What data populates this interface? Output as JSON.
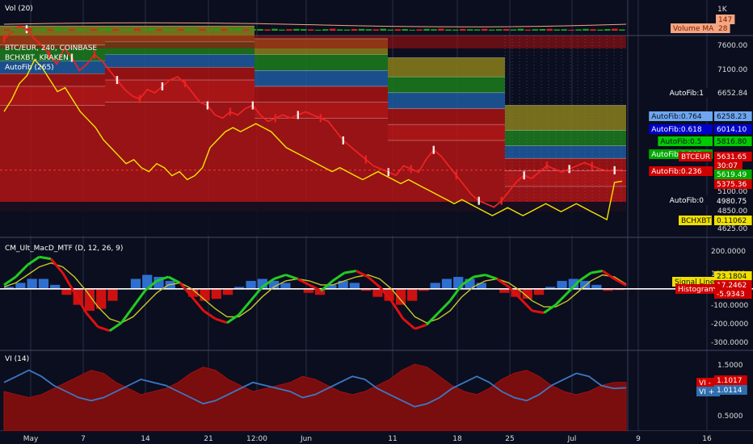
{
  "panes": {
    "volume": {
      "label": "Vol (20)",
      "axis_ticks": [
        "1K"
      ],
      "badges": [
        {
          "text": "147",
          "bg": "#f4a582",
          "fg": "#7a1e00"
        },
        {
          "text": "Volume MA",
          "bg": "#f4a582",
          "fg": "#7a1e00"
        },
        {
          "text": "28",
          "bg": "#f4a582",
          "fg": "#7a1e00"
        }
      ]
    },
    "price": {
      "labels": [
        "BTC/EUR, 240, COINBASE",
        "BCHXBT, KRAKEN",
        "AutoFib (265)"
      ],
      "axis_ticks": [
        "7600.00",
        "7100.00",
        "6652.84",
        "5100.00",
        "4850.00",
        "4625.00"
      ],
      "fib_labels": [
        "AutoFib:1",
        "AutoFib:0.764",
        "AutoFib:0.618",
        "AutoFib:0.5",
        "AutoFib:0.382",
        "AutoFib:0.236",
        "AutoFib:0"
      ],
      "badges": [
        {
          "text": "6258.23",
          "bg": "#6ea6f0",
          "fg": "#0b0e1e"
        },
        {
          "text": "6014.10",
          "bg": "#0000cc",
          "fg": "#ffffff"
        },
        {
          "text": "5816.80",
          "bg": "#00cc00",
          "fg": "#0b0e1e"
        },
        {
          "text": "BTCEUR",
          "bg": "#d00000",
          "fg": "#ffffff"
        },
        {
          "text": "5631.65",
          "bg": "#d00000",
          "fg": "#ffffff"
        },
        {
          "text": "30:07",
          "bg": "#d00000",
          "fg": "#ffffff"
        },
        {
          "text": "5619.49",
          "bg": "#00aa00",
          "fg": "#ffffff"
        },
        {
          "text": "5375.36",
          "bg": "#d00000",
          "fg": "#ffffff"
        },
        {
          "text": "4980.75",
          "bg": "#0b0e1e",
          "fg": "#ffffff"
        },
        {
          "text": "BCHXBT",
          "bg": "#f0e000",
          "fg": "#0b0e1e"
        },
        {
          "text": "0.11062",
          "bg": "#f0e000",
          "fg": "#0b0e1e"
        }
      ]
    },
    "macd": {
      "label": "CM_Ult_MacD_MTF (D, 12, 26, 9)",
      "axis_ticks": [
        "200.0000",
        "100.0000",
        "-100.0000",
        "-200.0000",
        "-300.0000"
      ],
      "badges": [
        {
          "text": "Signal Line",
          "bg": "#f0e000",
          "fg": "#0b0e1e"
        },
        {
          "text": "23.1804",
          "bg": "#f0e000",
          "fg": "#0b0e1e"
        },
        {
          "text": "17.2462",
          "bg": "#d00000",
          "fg": "#ffffff"
        },
        {
          "text": "Histogram",
          "bg": "#d00000",
          "fg": "#ffffff"
        },
        {
          "text": "-5.9343",
          "bg": "#d00000",
          "fg": "#ffffff"
        }
      ]
    },
    "vi": {
      "label": "VI (14)",
      "axis_ticks": [
        "1.5000",
        "0.5000"
      ],
      "badges": [
        {
          "text": "VI -",
          "bg": "#d00000",
          "fg": "#ffffff"
        },
        {
          "text": "1.1017",
          "bg": "#d00000",
          "fg": "#ffffff"
        },
        {
          "text": "VI +",
          "bg": "#2f6fb0",
          "fg": "#ffffff"
        },
        {
          "text": "1.0114",
          "bg": "#2f6fb0",
          "fg": "#ffffff"
        }
      ]
    }
  },
  "x_axis": [
    "May",
    "7",
    "14",
    "21",
    "12:00",
    "Jun",
    "11",
    "18",
    "25",
    "Jul",
    "9",
    "16"
  ],
  "colors": {
    "background": "#0b0e1e",
    "grid": "#2a2f48",
    "red": "#cc1111",
    "orange": "#d2691e",
    "yellow": "#f2e600",
    "green": "#1e9e1e",
    "blue": "#2b6cc4",
    "price_up": "#ffffff",
    "price_down": "#ee2222",
    "vi_plus": "#3b79c4",
    "vi_minus": "#8b1010"
  },
  "chart_data": [
    {
      "type": "bar",
      "title": "Vol (20)",
      "note_series": "volume bars (approx.)",
      "values": [
        40,
        55,
        30,
        70,
        45,
        60,
        35,
        90,
        50,
        40,
        65,
        30,
        45,
        55,
        80,
        40,
        35,
        50,
        60,
        45,
        70,
        40,
        55,
        30,
        45,
        60,
        35,
        50,
        40,
        65,
        45,
        55,
        70,
        30,
        45,
        50,
        40,
        60,
        35,
        45,
        55,
        50,
        40,
        30,
        45,
        60,
        40,
        35,
        50,
        55,
        45,
        40,
        60,
        35,
        45,
        50,
        30,
        40,
        55,
        45,
        60,
        40,
        35,
        50,
        45,
        40,
        55,
        35,
        45,
        50,
        40,
        60,
        35,
        45,
        50,
        55,
        40,
        45,
        30,
        40,
        55,
        45,
        35,
        50,
        60,
        40
      ],
      "series": [
        {
          "name": "Volume MA",
          "values": [
            28
          ]
        }
      ],
      "ylim": [
        0,
        1000
      ]
    },
    {
      "type": "line",
      "title": "BTC/EUR, 240, COINBASE",
      "series": [
        {
          "name": "BTCEUR",
          "values": [
            7700,
            7800,
            7900,
            7850,
            7700,
            7600,
            7450,
            7300,
            7550,
            7400,
            7200,
            7300,
            7450,
            7350,
            7200,
            7050,
            6900,
            6800,
            6750,
            6900,
            6850,
            6950,
            7050,
            7100,
            7000,
            6850,
            6700,
            6650,
            6500,
            6450,
            6550,
            6500,
            6600,
            6650,
            6500,
            6400,
            6450,
            6500,
            6450,
            6500,
            6550,
            6500,
            6450,
            6400,
            6250,
            6100,
            6000,
            5900,
            5800,
            5700,
            5650,
            5600,
            5550,
            5700,
            5650,
            5600,
            5800,
            5950,
            5850,
            5700,
            5550,
            5400,
            5250,
            5150,
            5100,
            5050,
            5150,
            5300,
            5450,
            5550,
            5500,
            5600,
            5700,
            5650,
            5600,
            5650,
            5700,
            5750,
            5700,
            5650,
            5620,
            5630,
            5631.65
          ]
        },
        {
          "name": "BCHXBT",
          "values": [
            0.128,
            0.131,
            0.135,
            0.137,
            0.141,
            0.139,
            0.136,
            0.133,
            0.134,
            0.131,
            0.128,
            0.126,
            0.124,
            0.121,
            0.119,
            0.117,
            0.115,
            0.116,
            0.114,
            0.113,
            0.115,
            0.114,
            0.112,
            0.113,
            0.111,
            0.112,
            0.114,
            0.119,
            0.121,
            0.123,
            0.124,
            0.123,
            0.124,
            0.125,
            0.124,
            0.123,
            0.121,
            0.119,
            0.118,
            0.117,
            0.116,
            0.115,
            0.114,
            0.113,
            0.114,
            0.113,
            0.112,
            0.111,
            0.112,
            0.113,
            0.112,
            0.111,
            0.11,
            0.111,
            0.11,
            0.109,
            0.108,
            0.107,
            0.106,
            0.105,
            0.106,
            0.105,
            0.104,
            0.103,
            0.102,
            0.103,
            0.104,
            0.103,
            0.102,
            0.103,
            0.104,
            0.105,
            0.104,
            0.103,
            0.104,
            0.105,
            0.104,
            0.103,
            0.102,
            0.101,
            0.1103,
            0.11062
          ]
        }
      ],
      "fib_levels": [
        {
          "name": "AutoFib:1",
          "value": 6652.84
        },
        {
          "name": "AutoFib:0.764",
          "value": 6258.23
        },
        {
          "name": "AutoFib:0.618",
          "value": 6014.1
        },
        {
          "name": "AutoFib:0.5",
          "value": 5816.8
        },
        {
          "name": "AutoFib:0.382",
          "value": 5619.49
        },
        {
          "name": "AutoFib:0.236",
          "value": 5375.36
        },
        {
          "name": "AutoFib:0",
          "value": 4980.75
        }
      ],
      "ylim": [
        4600,
        7750
      ]
    },
    {
      "type": "line",
      "title": "CM_Ult_MacD_MTF (D, 12, 26, 9)",
      "series": [
        {
          "name": "MacD",
          "values": [
            20,
            60,
            120,
            160,
            150,
            80,
            -20,
            -120,
            -190,
            -210,
            -170,
            -90,
            -10,
            40,
            60,
            30,
            -40,
            -110,
            -150,
            -170,
            -130,
            -60,
            10,
            50,
            70,
            50,
            20,
            -10,
            40,
            80,
            90,
            60,
            10,
            -60,
            -150,
            -200,
            -180,
            -120,
            -60,
            20,
            60,
            70,
            50,
            10,
            -50,
            -110,
            -120,
            -80,
            -20,
            40,
            80,
            90,
            50,
            17.2462
          ]
        },
        {
          "name": "Signal Line",
          "values": [
            10,
            30,
            70,
            110,
            130,
            110,
            60,
            -10,
            -90,
            -150,
            -170,
            -140,
            -80,
            -20,
            20,
            30,
            0,
            -50,
            -100,
            -140,
            -140,
            -100,
            -40,
            10,
            40,
            50,
            40,
            20,
            20,
            40,
            60,
            70,
            50,
            0,
            -70,
            -140,
            -170,
            -150,
            -110,
            -40,
            10,
            40,
            50,
            30,
            -10,
            -60,
            -90,
            -90,
            -60,
            -10,
            40,
            70,
            60,
            23.1804
          ]
        },
        {
          "name": "Histogram",
          "values": [
            10,
            30,
            50,
            50,
            20,
            -30,
            -80,
            -110,
            -100,
            -60,
            0,
            50,
            70,
            60,
            40,
            0,
            -40,
            -60,
            -50,
            -30,
            10,
            40,
            50,
            40,
            30,
            0,
            -20,
            -30,
            20,
            40,
            30,
            -10,
            -40,
            -60,
            -80,
            -60,
            -10,
            30,
            50,
            60,
            50,
            30,
            0,
            -20,
            -40,
            -50,
            -30,
            10,
            40,
            50,
            40,
            20,
            -10,
            -5.9343
          ]
        }
      ],
      "ylim": [
        -300,
        250
      ]
    },
    {
      "type": "area",
      "title": "VI (14)",
      "series": [
        {
          "name": "VI -",
          "values": [
            0.95,
            0.9,
            0.85,
            0.9,
            1.0,
            1.1,
            1.2,
            1.3,
            1.25,
            1.1,
            1.0,
            0.9,
            0.95,
            1.0,
            1.1,
            1.25,
            1.35,
            1.3,
            1.15,
            1.05,
            0.95,
            1.0,
            1.05,
            1.1,
            1.2,
            1.15,
            1.05,
            0.95,
            0.9,
            0.95,
            1.05,
            1.15,
            1.3,
            1.4,
            1.35,
            1.2,
            1.05,
            0.95,
            0.9,
            1.0,
            1.15,
            1.25,
            1.3,
            1.2,
            1.05,
            0.95,
            0.9,
            0.95,
            1.05,
            1.1,
            1.1017
          ]
        },
        {
          "name": "VI +",
          "values": [
            1.1,
            1.2,
            1.3,
            1.2,
            1.05,
            0.95,
            0.85,
            0.8,
            0.85,
            0.95,
            1.05,
            1.15,
            1.1,
            1.05,
            0.95,
            0.85,
            0.75,
            0.8,
            0.9,
            1.0,
            1.1,
            1.05,
            1.0,
            0.95,
            0.85,
            0.9,
            1.0,
            1.1,
            1.2,
            1.15,
            1.0,
            0.9,
            0.8,
            0.7,
            0.75,
            0.85,
            1.0,
            1.1,
            1.2,
            1.1,
            0.95,
            0.85,
            0.8,
            0.9,
            1.05,
            1.15,
            1.25,
            1.2,
            1.05,
            1.0,
            1.0114
          ]
        }
      ],
      "ylim": [
        0.3,
        1.6
      ]
    }
  ]
}
